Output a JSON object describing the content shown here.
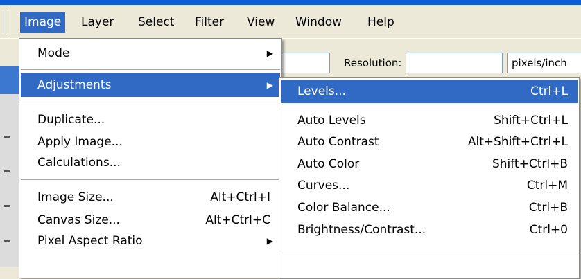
{
  "menubar": {
    "items": [
      "Image",
      "Layer",
      "Select",
      "Filter",
      "View",
      "Window",
      "Help"
    ]
  },
  "options_bar": {
    "resolution_label": "Resolution:",
    "unit_value": "pixels/inch"
  },
  "image_menu": {
    "items": [
      {
        "label": "Mode",
        "shortcut": "",
        "submenu": true
      },
      {
        "label": "Adjustments",
        "shortcut": "",
        "submenu": true
      },
      {
        "label": "Duplicate...",
        "shortcut": ""
      },
      {
        "label": "Apply Image...",
        "shortcut": ""
      },
      {
        "label": "Calculations...",
        "shortcut": ""
      },
      {
        "label": "Image Size...",
        "shortcut": "Alt+Ctrl+I"
      },
      {
        "label": "Canvas Size...",
        "shortcut": "Alt+Ctrl+C"
      },
      {
        "label": "Pixel Aspect Ratio",
        "shortcut": "",
        "submenu": true
      }
    ],
    "submenu_arrow": "▶"
  },
  "adjustments_menu": {
    "items": [
      {
        "label": "Levels...",
        "shortcut": "Ctrl+L"
      },
      {
        "label": "Auto Levels",
        "shortcut": "Shift+Ctrl+L"
      },
      {
        "label": "Auto Contrast",
        "shortcut": "Alt+Shift+Ctrl+L"
      },
      {
        "label": "Auto Color",
        "shortcut": "Shift+Ctrl+B"
      },
      {
        "label": "Curves...",
        "shortcut": "Ctrl+M"
      },
      {
        "label": "Color Balance...",
        "shortcut": "Ctrl+B"
      },
      {
        "label": "Brightness/Contrast...",
        "shortcut": "Ctrl+0"
      }
    ]
  },
  "colors": {
    "highlight": "#316ac5",
    "menubar_bg": "#ece9d8",
    "title_strip": "#0a5fd8"
  }
}
